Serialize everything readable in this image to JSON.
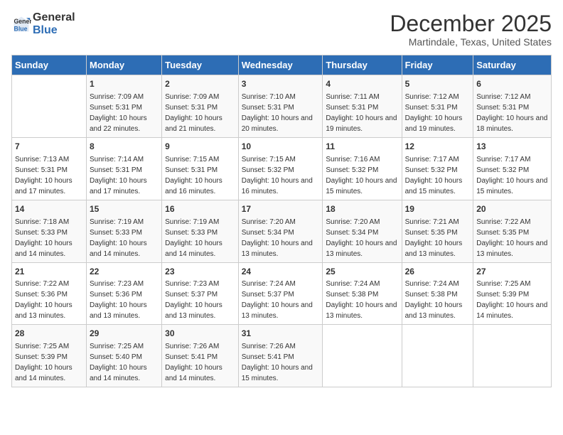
{
  "logo": {
    "line1": "General",
    "line2": "Blue"
  },
  "header": {
    "title": "December 2025",
    "subtitle": "Martindale, Texas, United States"
  },
  "days_of_week": [
    "Sunday",
    "Monday",
    "Tuesday",
    "Wednesday",
    "Thursday",
    "Friday",
    "Saturday"
  ],
  "weeks": [
    [
      {
        "day": "",
        "sunrise": "",
        "sunset": "",
        "daylight": ""
      },
      {
        "day": "1",
        "sunrise": "Sunrise: 7:09 AM",
        "sunset": "Sunset: 5:31 PM",
        "daylight": "Daylight: 10 hours and 22 minutes."
      },
      {
        "day": "2",
        "sunrise": "Sunrise: 7:09 AM",
        "sunset": "Sunset: 5:31 PM",
        "daylight": "Daylight: 10 hours and 21 minutes."
      },
      {
        "day": "3",
        "sunrise": "Sunrise: 7:10 AM",
        "sunset": "Sunset: 5:31 PM",
        "daylight": "Daylight: 10 hours and 20 minutes."
      },
      {
        "day": "4",
        "sunrise": "Sunrise: 7:11 AM",
        "sunset": "Sunset: 5:31 PM",
        "daylight": "Daylight: 10 hours and 19 minutes."
      },
      {
        "day": "5",
        "sunrise": "Sunrise: 7:12 AM",
        "sunset": "Sunset: 5:31 PM",
        "daylight": "Daylight: 10 hours and 19 minutes."
      },
      {
        "day": "6",
        "sunrise": "Sunrise: 7:12 AM",
        "sunset": "Sunset: 5:31 PM",
        "daylight": "Daylight: 10 hours and 18 minutes."
      }
    ],
    [
      {
        "day": "7",
        "sunrise": "Sunrise: 7:13 AM",
        "sunset": "Sunset: 5:31 PM",
        "daylight": "Daylight: 10 hours and 17 minutes."
      },
      {
        "day": "8",
        "sunrise": "Sunrise: 7:14 AM",
        "sunset": "Sunset: 5:31 PM",
        "daylight": "Daylight: 10 hours and 17 minutes."
      },
      {
        "day": "9",
        "sunrise": "Sunrise: 7:15 AM",
        "sunset": "Sunset: 5:31 PM",
        "daylight": "Daylight: 10 hours and 16 minutes."
      },
      {
        "day": "10",
        "sunrise": "Sunrise: 7:15 AM",
        "sunset": "Sunset: 5:32 PM",
        "daylight": "Daylight: 10 hours and 16 minutes."
      },
      {
        "day": "11",
        "sunrise": "Sunrise: 7:16 AM",
        "sunset": "Sunset: 5:32 PM",
        "daylight": "Daylight: 10 hours and 15 minutes."
      },
      {
        "day": "12",
        "sunrise": "Sunrise: 7:17 AM",
        "sunset": "Sunset: 5:32 PM",
        "daylight": "Daylight: 10 hours and 15 minutes."
      },
      {
        "day": "13",
        "sunrise": "Sunrise: 7:17 AM",
        "sunset": "Sunset: 5:32 PM",
        "daylight": "Daylight: 10 hours and 15 minutes."
      }
    ],
    [
      {
        "day": "14",
        "sunrise": "Sunrise: 7:18 AM",
        "sunset": "Sunset: 5:33 PM",
        "daylight": "Daylight: 10 hours and 14 minutes."
      },
      {
        "day": "15",
        "sunrise": "Sunrise: 7:19 AM",
        "sunset": "Sunset: 5:33 PM",
        "daylight": "Daylight: 10 hours and 14 minutes."
      },
      {
        "day": "16",
        "sunrise": "Sunrise: 7:19 AM",
        "sunset": "Sunset: 5:33 PM",
        "daylight": "Daylight: 10 hours and 14 minutes."
      },
      {
        "day": "17",
        "sunrise": "Sunrise: 7:20 AM",
        "sunset": "Sunset: 5:34 PM",
        "daylight": "Daylight: 10 hours and 13 minutes."
      },
      {
        "day": "18",
        "sunrise": "Sunrise: 7:20 AM",
        "sunset": "Sunset: 5:34 PM",
        "daylight": "Daylight: 10 hours and 13 minutes."
      },
      {
        "day": "19",
        "sunrise": "Sunrise: 7:21 AM",
        "sunset": "Sunset: 5:35 PM",
        "daylight": "Daylight: 10 hours and 13 minutes."
      },
      {
        "day": "20",
        "sunrise": "Sunrise: 7:22 AM",
        "sunset": "Sunset: 5:35 PM",
        "daylight": "Daylight: 10 hours and 13 minutes."
      }
    ],
    [
      {
        "day": "21",
        "sunrise": "Sunrise: 7:22 AM",
        "sunset": "Sunset: 5:36 PM",
        "daylight": "Daylight: 10 hours and 13 minutes."
      },
      {
        "day": "22",
        "sunrise": "Sunrise: 7:23 AM",
        "sunset": "Sunset: 5:36 PM",
        "daylight": "Daylight: 10 hours and 13 minutes."
      },
      {
        "day": "23",
        "sunrise": "Sunrise: 7:23 AM",
        "sunset": "Sunset: 5:37 PM",
        "daylight": "Daylight: 10 hours and 13 minutes."
      },
      {
        "day": "24",
        "sunrise": "Sunrise: 7:24 AM",
        "sunset": "Sunset: 5:37 PM",
        "daylight": "Daylight: 10 hours and 13 minutes."
      },
      {
        "day": "25",
        "sunrise": "Sunrise: 7:24 AM",
        "sunset": "Sunset: 5:38 PM",
        "daylight": "Daylight: 10 hours and 13 minutes."
      },
      {
        "day": "26",
        "sunrise": "Sunrise: 7:24 AM",
        "sunset": "Sunset: 5:38 PM",
        "daylight": "Daylight: 10 hours and 13 minutes."
      },
      {
        "day": "27",
        "sunrise": "Sunrise: 7:25 AM",
        "sunset": "Sunset: 5:39 PM",
        "daylight": "Daylight: 10 hours and 14 minutes."
      }
    ],
    [
      {
        "day": "28",
        "sunrise": "Sunrise: 7:25 AM",
        "sunset": "Sunset: 5:39 PM",
        "daylight": "Daylight: 10 hours and 14 minutes."
      },
      {
        "day": "29",
        "sunrise": "Sunrise: 7:25 AM",
        "sunset": "Sunset: 5:40 PM",
        "daylight": "Daylight: 10 hours and 14 minutes."
      },
      {
        "day": "30",
        "sunrise": "Sunrise: 7:26 AM",
        "sunset": "Sunset: 5:41 PM",
        "daylight": "Daylight: 10 hours and 14 minutes."
      },
      {
        "day": "31",
        "sunrise": "Sunrise: 7:26 AM",
        "sunset": "Sunset: 5:41 PM",
        "daylight": "Daylight: 10 hours and 15 minutes."
      },
      {
        "day": "",
        "sunrise": "",
        "sunset": "",
        "daylight": ""
      },
      {
        "day": "",
        "sunrise": "",
        "sunset": "",
        "daylight": ""
      },
      {
        "day": "",
        "sunrise": "",
        "sunset": "",
        "daylight": ""
      }
    ]
  ]
}
